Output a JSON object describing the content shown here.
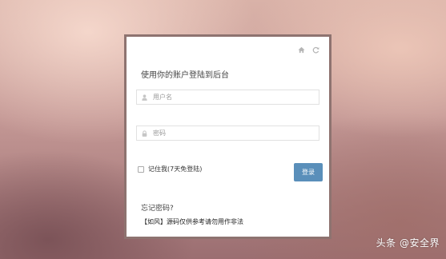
{
  "login": {
    "title": "使用你的账户登陆到后台",
    "username_placeholder": "用户名",
    "password_placeholder": "密码",
    "remember_label": "记住我(7天免登陆)",
    "login_button": "登录",
    "forgot_link": "忘记密码?",
    "notice": "【如风】源码仅供参考请勿用作非法"
  },
  "icons": {
    "home": "home-icon",
    "refresh": "refresh-icon",
    "user": "user-icon",
    "lock": "lock-icon"
  },
  "watermark": "头条 @安全界",
  "colors": {
    "accent": "#5a8fba",
    "panel_border": "#8e7370"
  }
}
